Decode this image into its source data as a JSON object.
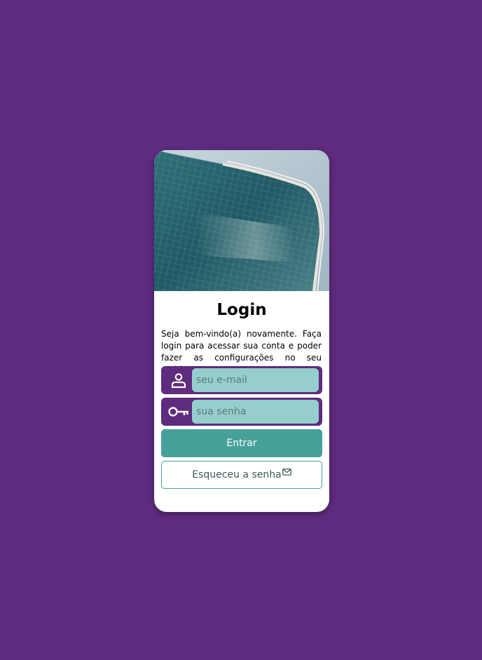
{
  "login": {
    "title": "Login",
    "description": "Seja bem-vindo(a) novamente. Faça login para acessar sua conta e poder fazer as configurações no seu ambiente.",
    "email_placeholder": "seu e-mail",
    "password_placeholder": "sua senha",
    "submit_label": "Entrar",
    "forgot_label": "Esqueceu a senha"
  },
  "icons": {
    "hero": "building-photo",
    "email": "user-icon",
    "password": "key-icon",
    "forgot": "mail-icon"
  },
  "colors": {
    "background": "#5e2b7e",
    "input_fill": "#95cecc",
    "accent": "#48a09a",
    "card": "#ffffff"
  }
}
